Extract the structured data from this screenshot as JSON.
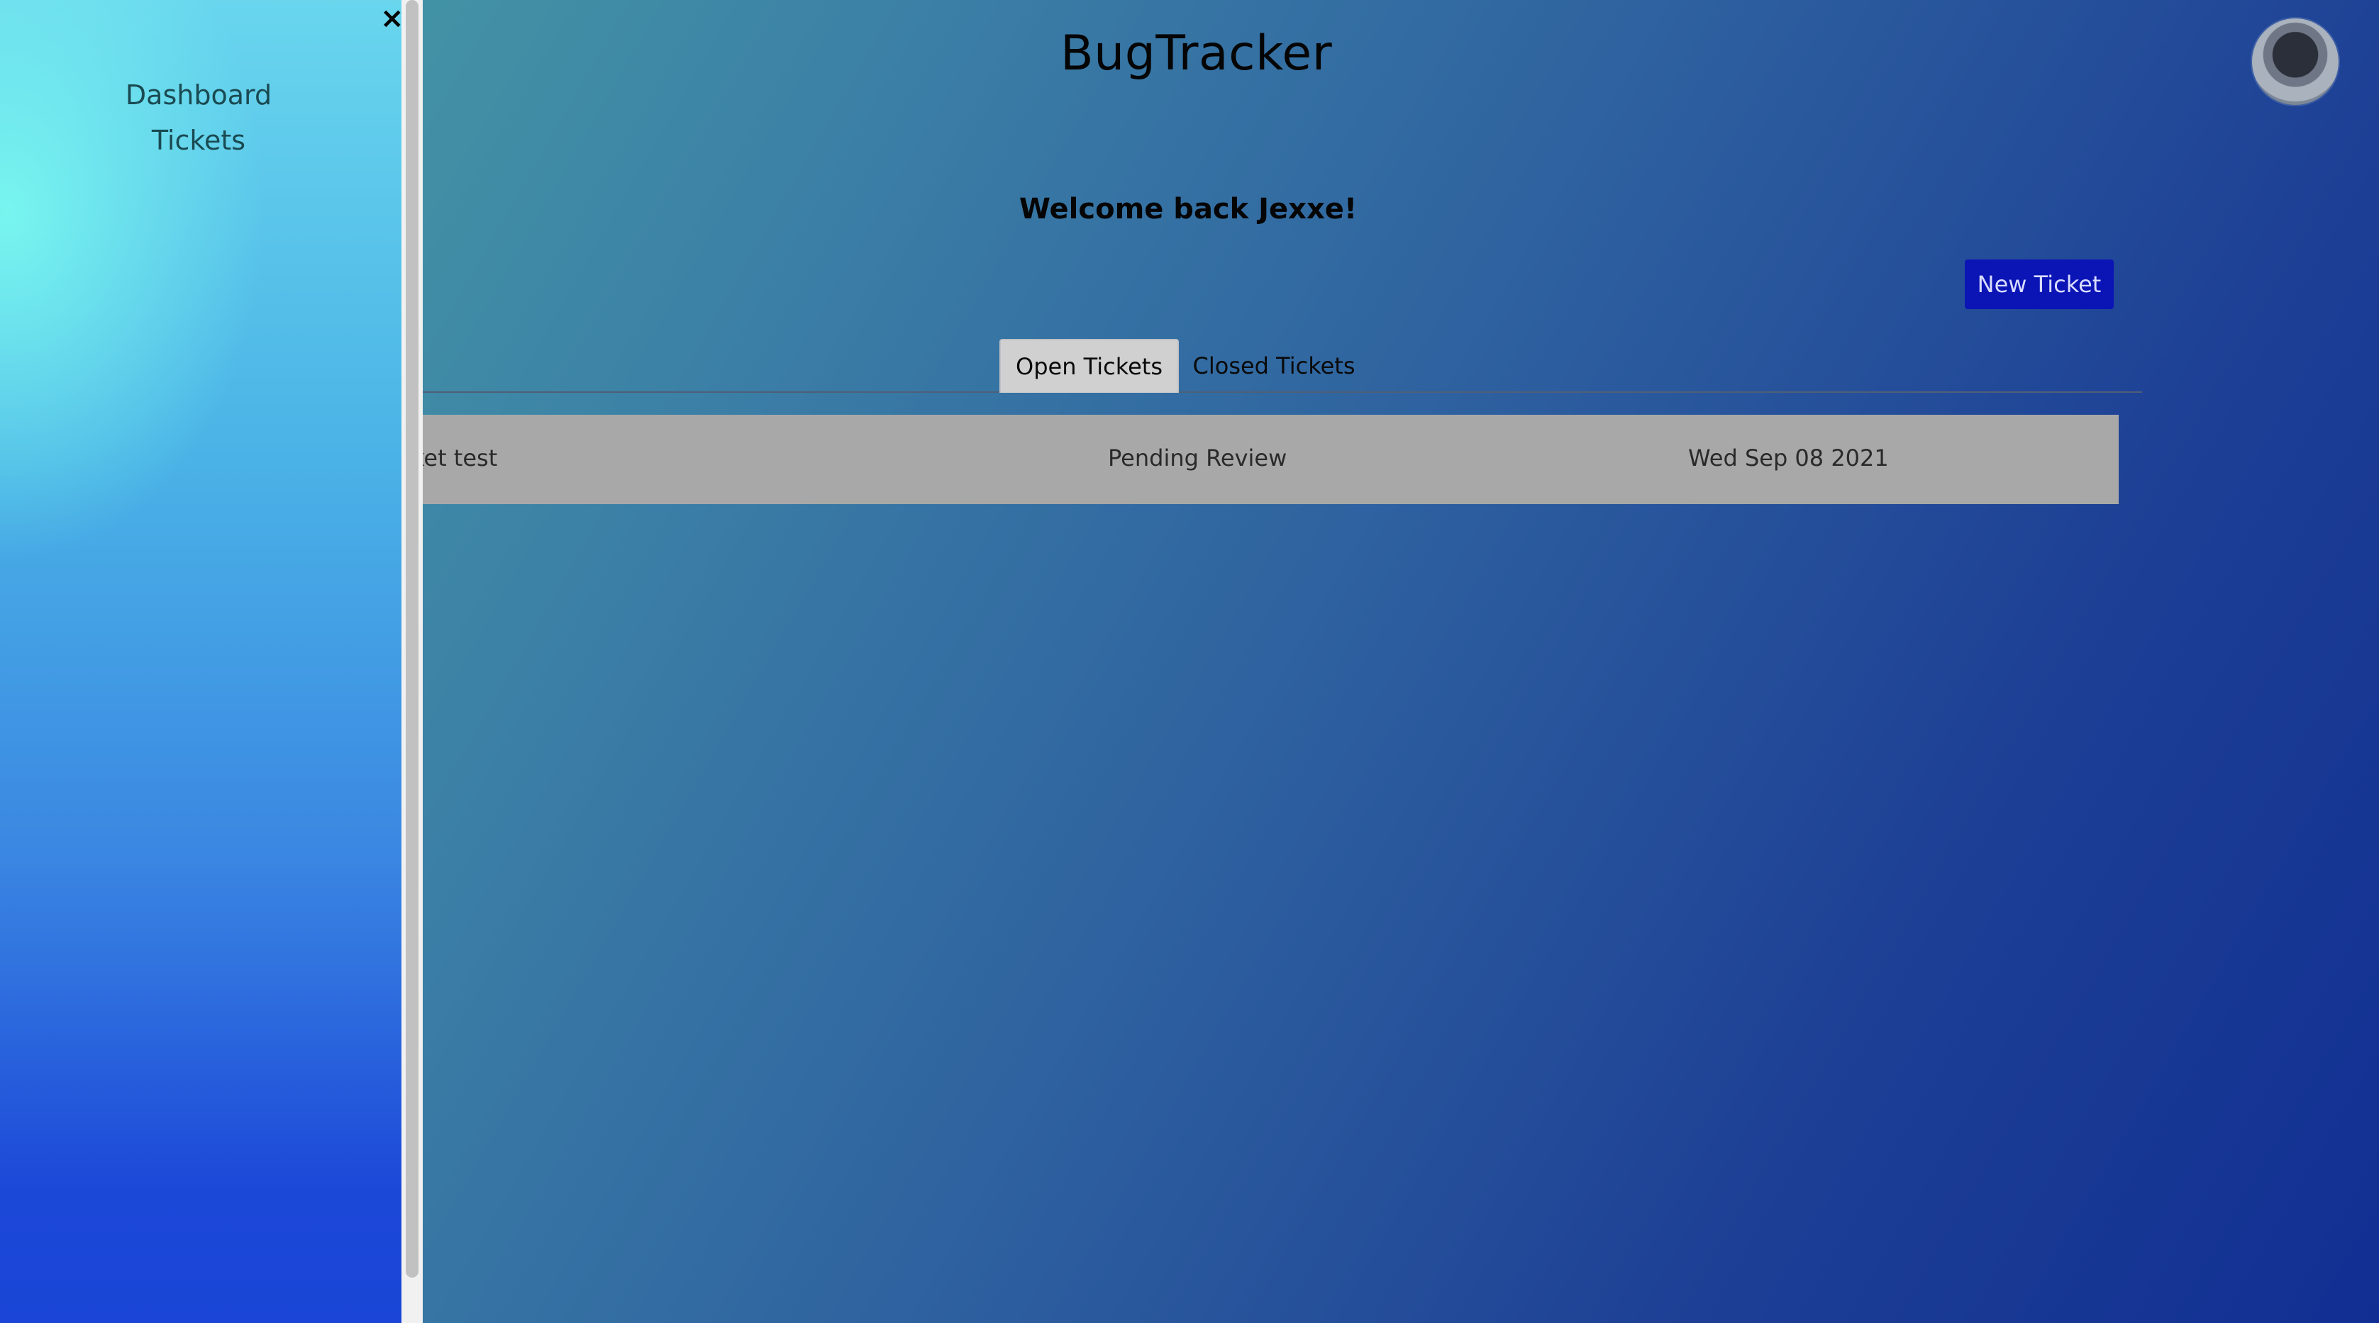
{
  "header": {
    "app_title": "BugTracker",
    "avatar": "user-avatar"
  },
  "welcome_message": "Welcome back Jexxe!",
  "actions": {
    "new_ticket_label": "New Ticket"
  },
  "tabs": [
    {
      "label": "Open Tickets",
      "active": true
    },
    {
      "label": "Closed Tickets",
      "active": false
    }
  ],
  "tickets": [
    {
      "title": "ket test",
      "status": "Pending Review",
      "date": "Wed Sep 08 2021"
    }
  ],
  "sidebar": {
    "close_icon": "×",
    "items": [
      {
        "label": "Dashboard"
      },
      {
        "label": "Tickets"
      }
    ]
  },
  "colors": {
    "primary_button": "#0b14b5",
    "row_background": "#a8a8a8",
    "tab_active": "#d0d0d0"
  }
}
